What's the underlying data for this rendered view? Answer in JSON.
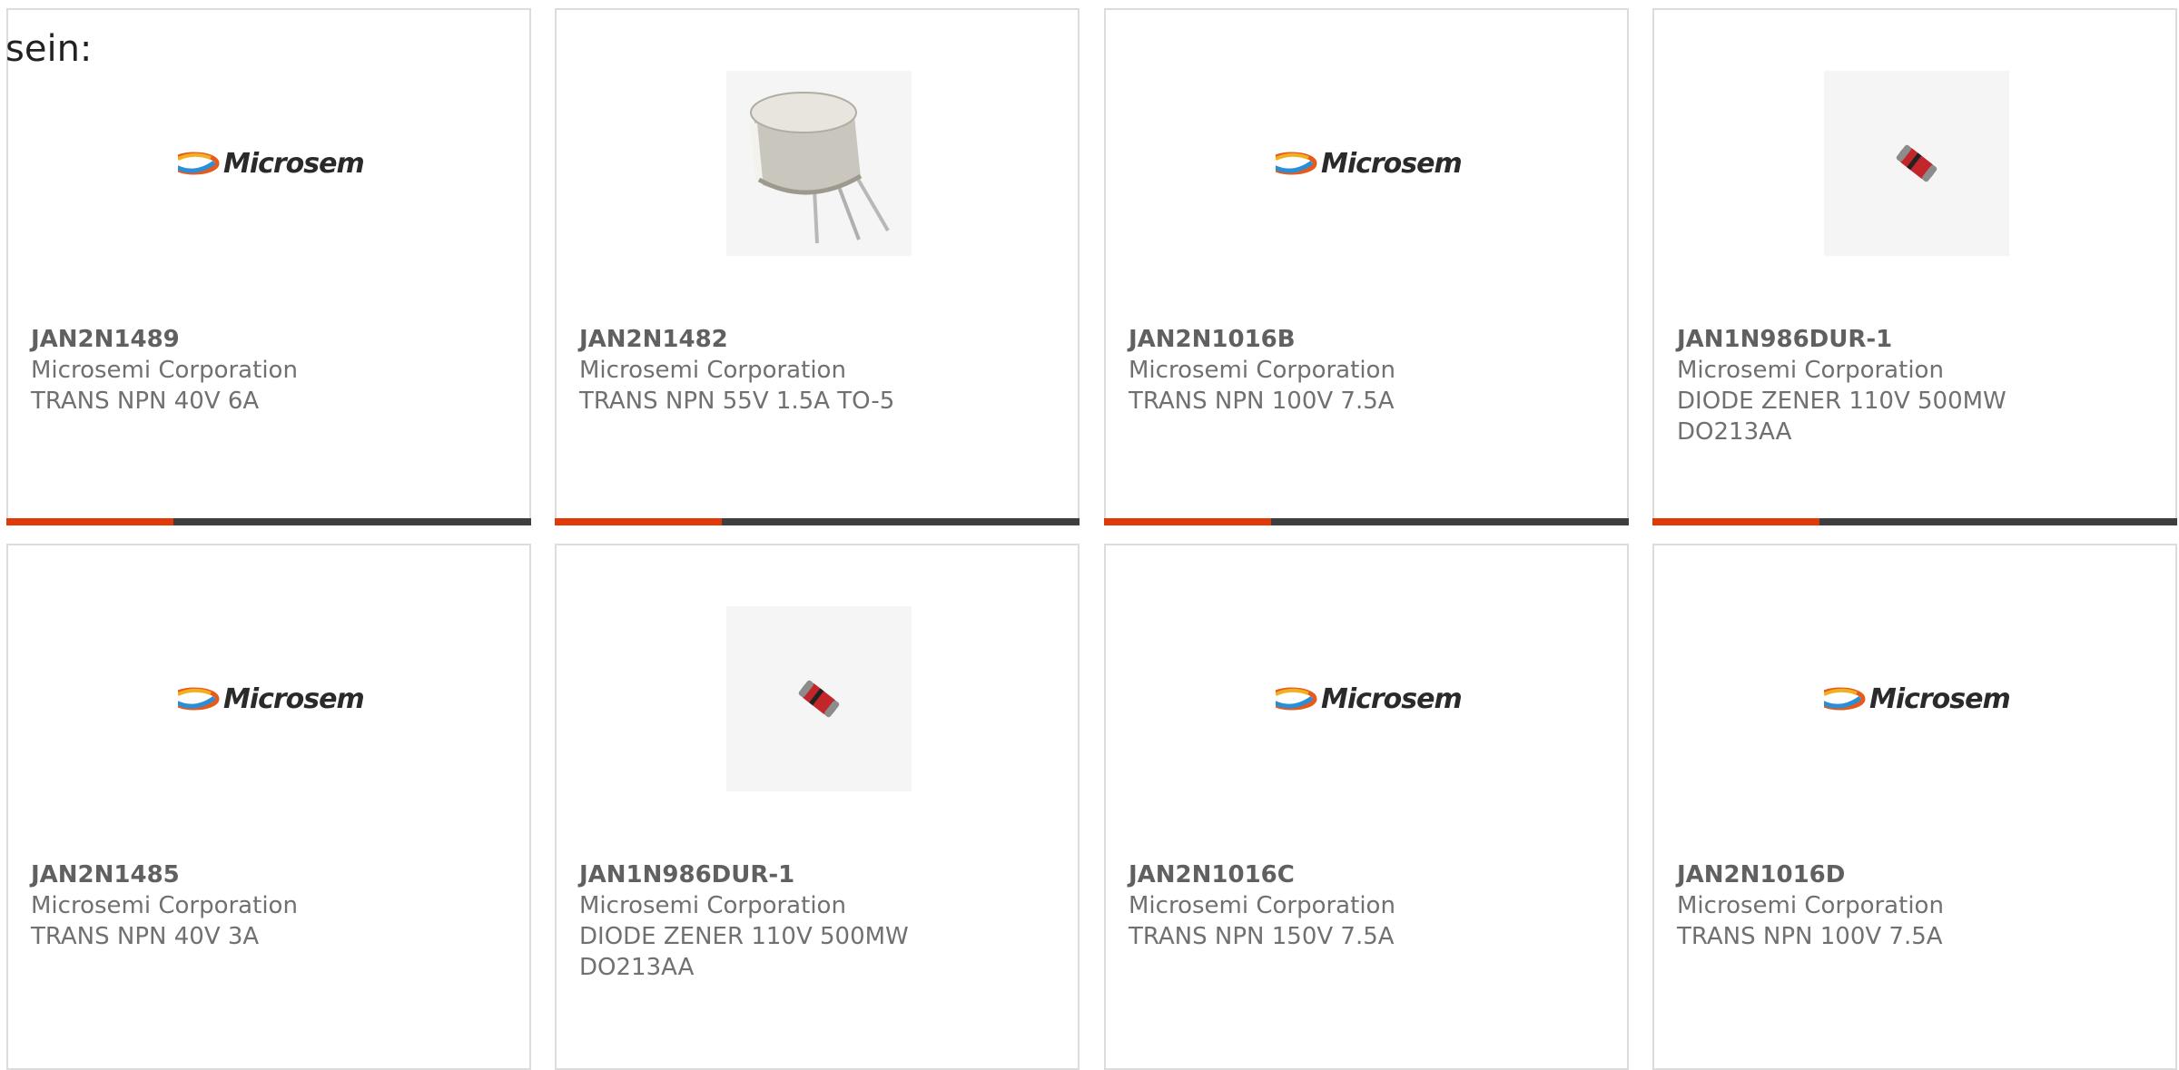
{
  "page": {
    "heading": "sein:"
  },
  "products": [
    {
      "part_number": "JAN2N1489",
      "manufacturer": "Microsemi Corporation",
      "description": "TRANS NPN 40V 6A",
      "image": "microsemi-logo",
      "logo_text": "Microsemi"
    },
    {
      "part_number": "JAN2N1482",
      "manufacturer": "Microsemi Corporation",
      "description": "TRANS NPN 55V 1.5A TO-5",
      "image": "to5-transistor-photo",
      "logo_text": ""
    },
    {
      "part_number": "JAN2N1016B",
      "manufacturer": "Microsemi Corporation",
      "description": "TRANS NPN 100V 7.5A",
      "image": "microsemi-logo",
      "logo_text": "Microsemi"
    },
    {
      "part_number": "JAN1N986DUR-1",
      "manufacturer": "Microsemi Corporation",
      "description": "DIODE ZENER 110V 500MW DO213AA",
      "image": "do213aa-diode-photo",
      "logo_text": ""
    },
    {
      "part_number": "JAN2N1485",
      "manufacturer": "Microsemi Corporation",
      "description": "TRANS NPN 40V 3A",
      "image": "microsemi-logo",
      "logo_text": "Microsemi"
    },
    {
      "part_number": "JAN1N986DUR-1",
      "manufacturer": "Microsemi Corporation",
      "description": "DIODE ZENER 110V 500MW DO213AA",
      "image": "do213aa-diode-photo",
      "logo_text": ""
    },
    {
      "part_number": "JAN2N1016C",
      "manufacturer": "Microsemi Corporation",
      "description": "TRANS NPN 150V 7.5A",
      "image": "microsemi-logo",
      "logo_text": "Microsemi"
    },
    {
      "part_number": "JAN2N1016D",
      "manufacturer": "Microsemi Corporation",
      "description": "TRANS NPN 100V 7.5A",
      "image": "microsemi-logo",
      "logo_text": "Microsemi"
    }
  ],
  "colors": {
    "accent": "#e13a09",
    "bar": "#3e3e3e",
    "border": "#dcdcdc",
    "text": "#707070"
  }
}
